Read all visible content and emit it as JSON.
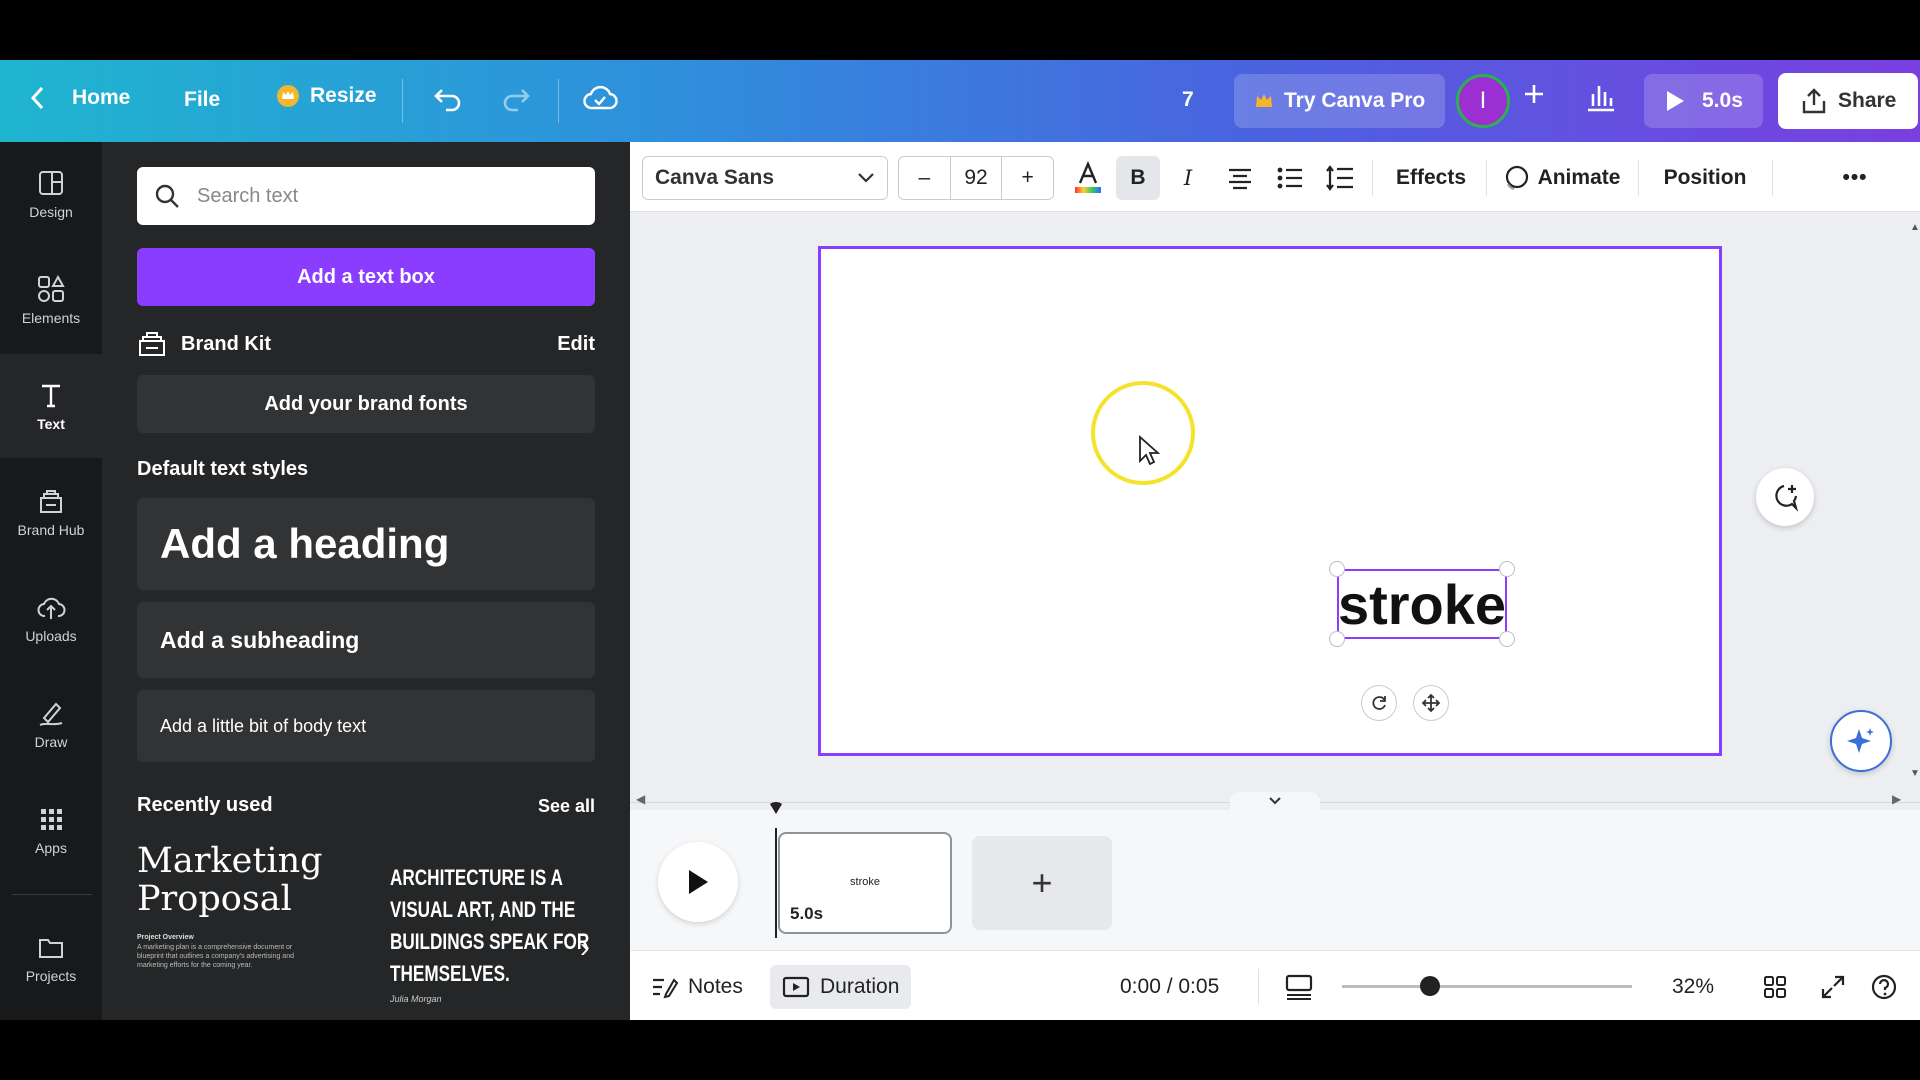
{
  "topbar": {
    "home_label": "Home",
    "file_label": "File",
    "resize_label": "Resize",
    "count_value": "7",
    "try_pro_label": "Try Canva Pro",
    "avatar_initial": "I",
    "play_duration": "5.0s",
    "share_label": "Share"
  },
  "rail": {
    "items": [
      {
        "label": "Design",
        "icon": "design-icon"
      },
      {
        "label": "Elements",
        "icon": "elements-icon"
      },
      {
        "label": "Text",
        "icon": "text-icon"
      },
      {
        "label": "Brand Hub",
        "icon": "brand-hub-icon"
      },
      {
        "label": "Uploads",
        "icon": "uploads-icon"
      },
      {
        "label": "Draw",
        "icon": "draw-icon"
      },
      {
        "label": "Apps",
        "icon": "apps-icon"
      },
      {
        "label": "Projects",
        "icon": "projects-icon"
      }
    ]
  },
  "panel": {
    "search_placeholder": "Search text",
    "add_text_box_label": "Add a text box",
    "brand_kit_label": "Brand Kit",
    "brand_kit_edit": "Edit",
    "add_brand_fonts_label": "Add your brand fonts",
    "default_styles_title": "Default text styles",
    "heading_label": "Add a heading",
    "subheading_label": "Add a subheading",
    "body_label": "Add a little bit of body text",
    "recently_used_title": "Recently used",
    "see_all_label": "See all",
    "recent": {
      "a_title_line1": "Marketing",
      "a_title_line2": "Proposal",
      "a_sub_heading": "Project Overview",
      "a_sub_body": "A marketing plan is a comprehensive document or blueprint that outlines a company's advertising and marketing efforts for the coming year.",
      "b_line1": "ARCHITECTURE IS A",
      "b_line2": "VISUAL ART, AND THE",
      "b_line3": "BUILDINGS SPEAK FOR",
      "b_line4": "THEMSELVES.",
      "b_author": "Julia Morgan"
    }
  },
  "toolbar": {
    "font_name": "Canva Sans",
    "font_size": "92",
    "minus_label": "–",
    "plus_label": "+",
    "bold_label": "B",
    "italic_label": "I",
    "effects_label": "Effects",
    "animate_label": "Animate",
    "position_label": "Position",
    "more_label": "•••"
  },
  "canvas": {
    "text_element": "stroke"
  },
  "timeline": {
    "clip_name": "stroke",
    "clip_duration": "5.0s",
    "add_label": "+"
  },
  "bottombar": {
    "notes_label": "Notes",
    "duration_label": "Duration",
    "time_readout": "0:00 / 0:05",
    "zoom_level": "32%"
  },
  "colors": {
    "accent": "#8b3dff",
    "rail_bg": "#18191b",
    "panel_bg": "#252627",
    "cursor_highlight": "#f5e22c"
  }
}
